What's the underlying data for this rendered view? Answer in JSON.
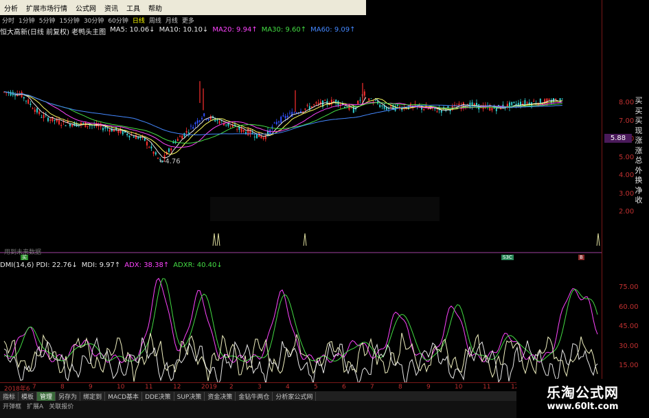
{
  "menubar": {
    "items": [
      "分析",
      "扩展市场行情",
      "公式网",
      "资讯",
      "工具",
      "帮助"
    ]
  },
  "period_bar": {
    "items": [
      "分时",
      "1分钟",
      "5分钟",
      "15分钟",
      "30分钟",
      "60分钟",
      "日线",
      "周线",
      "月线",
      "更多"
    ],
    "active": "日线"
  },
  "main_legend": {
    "title": "恒大高新(日线 前复权) 老鸭头主图",
    "items": [
      {
        "label": "MA5: 10.06↓",
        "color": "#e8e8e8"
      },
      {
        "label": "MA10: 10.10↓",
        "color": "#e8e8e8"
      },
      {
        "label": "MA20: 9.94↑",
        "color": "#ff44ff"
      },
      {
        "label": "MA30: 9.60↑",
        "color": "#44dd44"
      },
      {
        "label": "MA60: 9.09↑",
        "color": "#4488ff"
      }
    ]
  },
  "price_scale": [
    "8.00",
    "7.00",
    "6.00",
    "5.00",
    "4.00",
    "3.00",
    "2.00"
  ],
  "price_badge": "5.88",
  "low_label": "←4.76",
  "vertical_menu": [
    "买",
    "买",
    "买",
    "现",
    "涨",
    "涨",
    "总",
    "外",
    "换",
    "净",
    "收"
  ],
  "signal_row": {
    "label": "用到未来数据",
    "badges": [
      {
        "text": "买",
        "color": "#2a8a2a"
      },
      {
        "text": "S3C",
        "color": "#2a8a5a"
      },
      {
        "text": "B",
        "color": "#8a2a2a"
      }
    ]
  },
  "dmi_legend": {
    "items": [
      {
        "label": "DMI(14,6) PDI: 22.76↓",
        "color": "#e8e8e8"
      },
      {
        "label": "MDI: 9.97↑",
        "color": "#e8e8e8"
      },
      {
        "label": "ADX: 38.38↑",
        "color": "#ff44ff"
      },
      {
        "label": "ADXR: 40.40↓",
        "color": "#44dd44"
      }
    ]
  },
  "dmi_scale": [
    "75.00",
    "60.00",
    "45.00",
    "30.00",
    "15.00"
  ],
  "date_axis": [
    "2018年6",
    "7",
    "8",
    "9",
    "10",
    "11",
    "12",
    "2019",
    "2",
    "3",
    "4",
    "5",
    "6",
    "7",
    "8",
    "9",
    "10",
    "11",
    "12",
    "2020"
  ],
  "bottom_tabs": {
    "items": [
      "指标",
      "模板",
      "管理",
      "另存为",
      "绑定到",
      "MACD基本",
      "DDE决策",
      "SUP决策",
      "资金决策",
      "金钻牛两仓",
      "分析家公式网"
    ],
    "active": "管理"
  },
  "bottom_tabs2": [
    "开弹框",
    "扩展A",
    "关联报价"
  ],
  "watermark": {
    "cn": "乐淘公式网",
    "url": "www.60lt.com"
  },
  "colors": {
    "up": "#ff3030",
    "down": "#30d0d0",
    "ma5": "#e8e8e8",
    "ma10": "#ffff60",
    "ma20": "#ff44ff",
    "ma30": "#44dd44",
    "ma60": "#4488ff",
    "duck": "#3050ff"
  }
}
